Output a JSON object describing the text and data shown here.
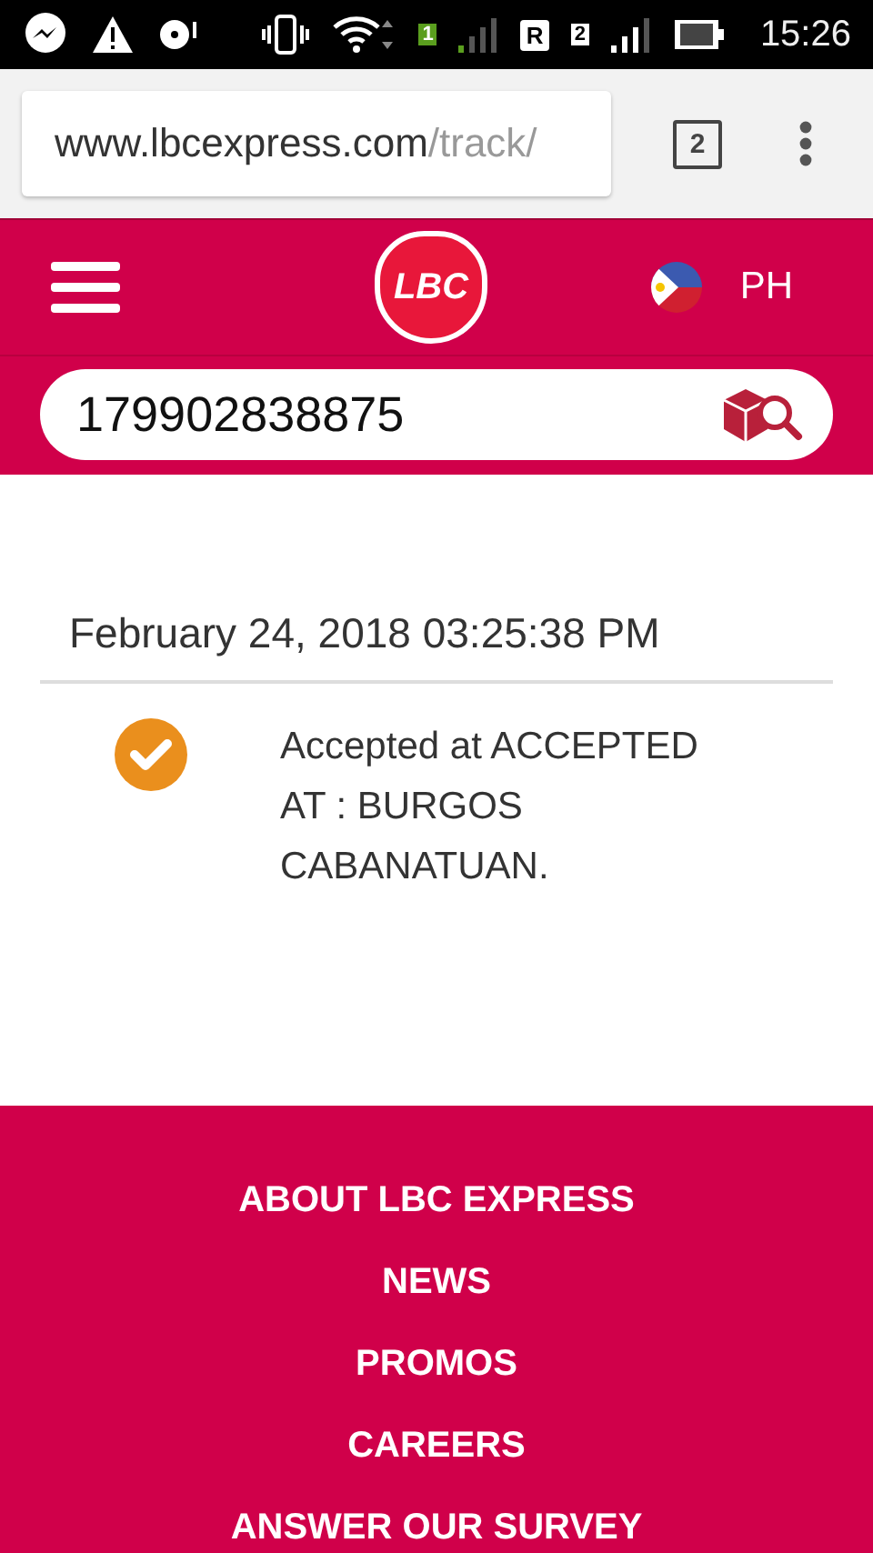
{
  "status_bar": {
    "sim_1": "1",
    "roaming": "R",
    "sim_2": "2",
    "time": "15:26"
  },
  "browser": {
    "url_host": "www.lbcexpress.com",
    "url_path": "/track/",
    "tab_count": "2"
  },
  "header": {
    "logo": "LBC",
    "region": "PH"
  },
  "search": {
    "value": "179902838875"
  },
  "tracking": {
    "date": "February 24, 2018 03:25:38 PM",
    "events": [
      {
        "text": "Accepted at ACCEPTED AT : BURGOS CABANATUAN.",
        "completed": true
      }
    ]
  },
  "footer": {
    "links": [
      "ABOUT LBC EXPRESS",
      "NEWS",
      "PROMOS",
      "CAREERS",
      "ANSWER OUR SURVEY"
    ]
  }
}
